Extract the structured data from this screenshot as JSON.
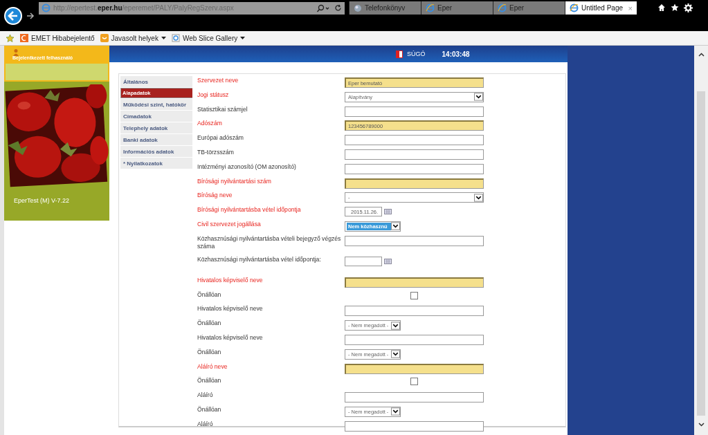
{
  "browser": {
    "address": "http://epertest.**eper.hu**/eperemet/PALY/PalyRegSzerv.aspx",
    "tabs": [
      {
        "label": "Telefonkönyv",
        "selected": false
      },
      {
        "label": "Eper",
        "selected": false
      },
      {
        "label": "Eper",
        "selected": false
      },
      {
        "label": "Untitled Page",
        "selected": true,
        "close": "×"
      }
    ],
    "favorites": [
      {
        "label": "EMET Hibabejelentő",
        "menu": false
      },
      {
        "label": "Javasolt helyek",
        "menu": true
      },
      {
        "label": "Web Slice Gallery",
        "menu": true
      }
    ]
  },
  "user": {
    "label": "Bejelentkezett felhasználó"
  },
  "header": {
    "help": "SÚGÓ",
    "time": "14:03:48"
  },
  "version": "EperTest (M) V-7.22",
  "nav": [
    {
      "label": "Általános",
      "selected": false
    },
    {
      "label": "Alapadatok",
      "selected": true
    },
    {
      "label": "Működési szint, hatókör",
      "selected": false
    },
    {
      "label": "Címadatok",
      "selected": false
    },
    {
      "label": "Telephely adatok",
      "selected": false
    },
    {
      "label": "Banki adatok",
      "selected": false
    },
    {
      "label": "Információs adatok",
      "selected": false
    },
    {
      "label": "* Nyilatkozatok",
      "selected": false
    }
  ],
  "fields": [
    {
      "label": "Szervezet neve",
      "required": true,
      "kind": "text",
      "value": "Eper bemutató"
    },
    {
      "label": "Jogi státusz",
      "required": true,
      "kind": "select",
      "value": "Alapítvány",
      "focused": false
    },
    {
      "label": "Statisztikai számjel",
      "required": false,
      "kind": "text"
    },
    {
      "label": "Adószám",
      "required": true,
      "kind": "text",
      "value": "123456789000"
    },
    {
      "label": "Európai adószám",
      "required": false,
      "kind": "text"
    },
    {
      "label": "TB-törzsszám",
      "required": false,
      "kind": "text"
    },
    {
      "label": "Intézményi azonosító (OM azonosító)",
      "required": false,
      "kind": "text"
    },
    {
      "label": "Bírósági nyilvántartási szám",
      "required": true,
      "kind": "text"
    },
    {
      "label": "Bíróság neve",
      "required": true,
      "kind": "select",
      "value": "-",
      "focused": false
    },
    {
      "label": "Bírósági nyilvántartásba vétel időpontja",
      "required": true,
      "kind": "date",
      "value": "2015.11.26."
    },
    {
      "label": "Civil szervezet jogállása",
      "required": true,
      "kind": "short-select",
      "value": "Nem közhasznú",
      "focused": true
    },
    {
      "label": "Közhasznúsági nyilvántartásba vételi bejegyző végzés száma",
      "required": false,
      "kind": "text"
    },
    {
      "label": "Közhasznúsági nyilvántartásba vétel időpontja:",
      "required": false,
      "kind": "date"
    },
    {
      "label": "Hivatalos képviselő neve",
      "required": true,
      "kind": "text"
    },
    {
      "label": "Önállóan",
      "required": false,
      "kind": "checkbox",
      "checked": false
    },
    {
      "label": "Hivatalos képviselő neve",
      "required": false,
      "kind": "text"
    },
    {
      "label": "Önállóan",
      "required": false,
      "kind": "short-select",
      "value": "- Nem megadott -",
      "focused": false
    },
    {
      "label": "Hivatalos képviselő neve",
      "required": false,
      "kind": "text"
    },
    {
      "label": "Önállóan",
      "required": false,
      "kind": "short-select",
      "value": "- Nem megadott -",
      "focused": false
    },
    {
      "label": "Aláíró neve",
      "required": true,
      "kind": "text"
    },
    {
      "label": "Önállóan",
      "required": false,
      "kind": "checkbox",
      "checked": false
    },
    {
      "label": "Aláíró",
      "required": false,
      "kind": "text"
    },
    {
      "label": "Önállóan",
      "required": false,
      "kind": "short-select",
      "value": "- Nem megadott -",
      "focused": false
    },
    {
      "label": "Aláíró",
      "required": false,
      "kind": "text"
    }
  ]
}
